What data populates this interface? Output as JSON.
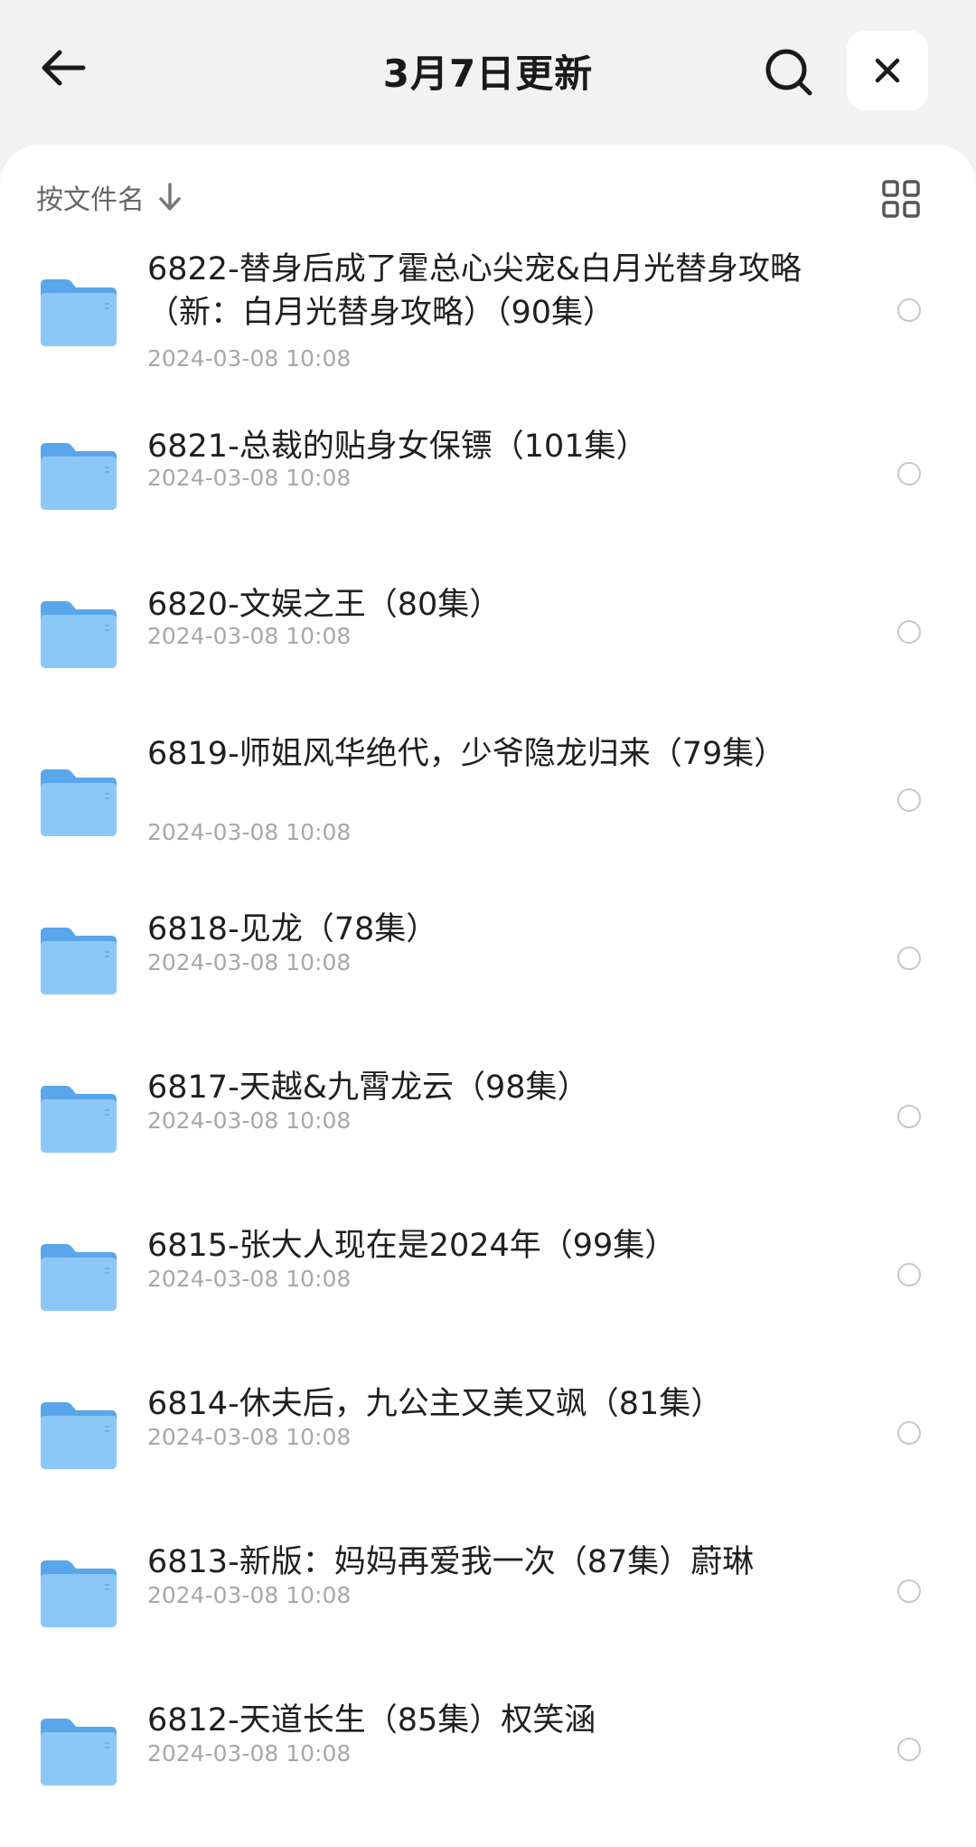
{
  "header": {
    "title": "3月7日更新"
  },
  "sortbar": {
    "label": "按文件名"
  },
  "icons": {
    "back": "back-arrow-icon",
    "search": "search-icon",
    "close": "close-icon",
    "sort": "arrow-down-icon",
    "grid": "grid-view-icon",
    "folder": "folder-icon"
  },
  "colors": {
    "folder": "#6fb4f0",
    "header_bg": "#f2f2f2"
  },
  "files": [
    {
      "name": "6822-替身后成了霍总心尖宠&白月光替身攻略（新：白月光替身攻略）（90集）",
      "date": "2024-03-08 10:08"
    },
    {
      "name": "6821-总裁的贴身女保镖（101集）",
      "date": "2024-03-08 10:08"
    },
    {
      "name": "6820-文娱之王（80集）",
      "date": "2024-03-08 10:08"
    },
    {
      "name": "6819-师姐风华绝代，少爷隐龙归来（79集）",
      "date": "2024-03-08 10:08"
    },
    {
      "name": "6818-见龙（78集）",
      "date": "2024-03-08 10:08"
    },
    {
      "name": "6817-天越&九霄龙云（98集）",
      "date": "2024-03-08 10:08"
    },
    {
      "name": "6815-张大人现在是2024年（99集）",
      "date": "2024-03-08 10:08"
    },
    {
      "name": "6814-休夫后，九公主又美又飒（81集）",
      "date": "2024-03-08 10:08"
    },
    {
      "name": "6813-新版：妈妈再爱我一次（87集）蔚琳",
      "date": "2024-03-08 10:08"
    },
    {
      "name": "6812-天道长生（85集）权笑涵",
      "date": "2024-03-08 10:08"
    }
  ]
}
